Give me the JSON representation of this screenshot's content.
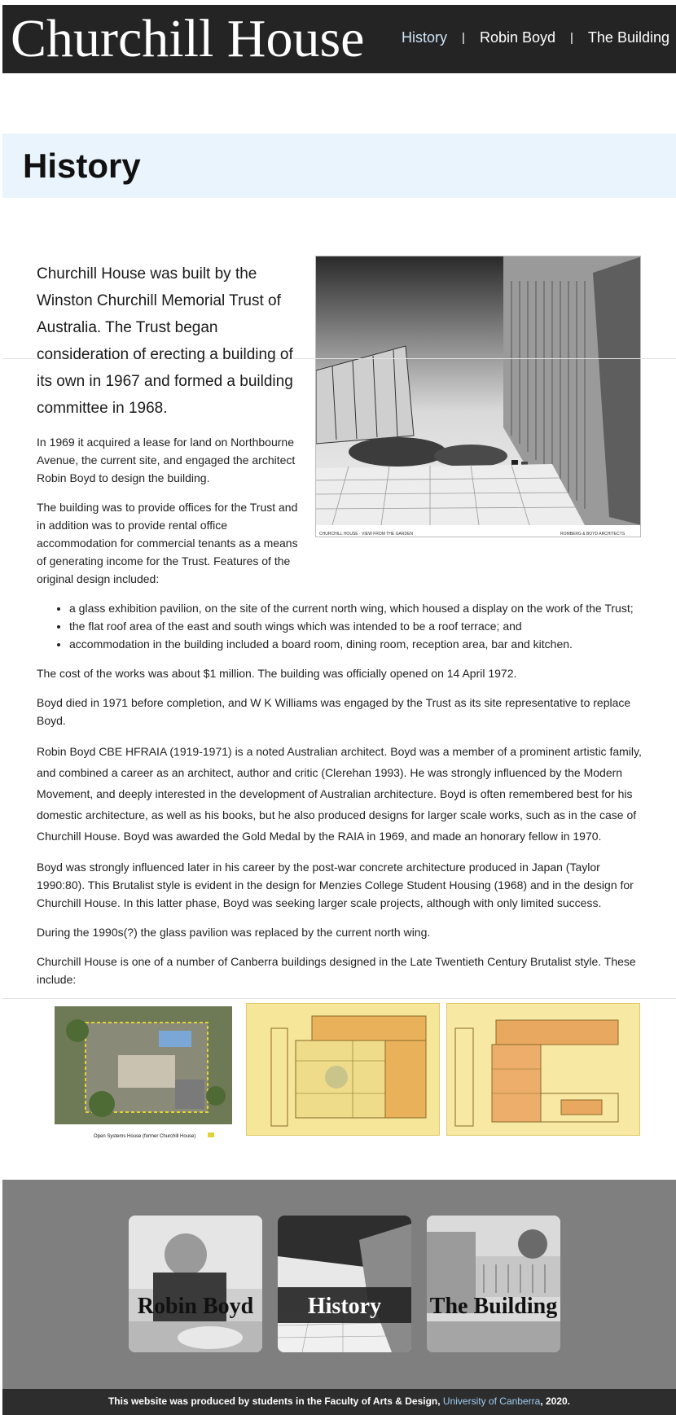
{
  "header": {
    "title": "Churchill House",
    "nav": [
      {
        "label": "History"
      },
      {
        "label": "Robin Boyd"
      },
      {
        "label": "The Building"
      }
    ],
    "separator": "|"
  },
  "banner": {
    "heading": "History"
  },
  "content": {
    "lead": "Churchill House was built by the Winston Churchill Memorial Trust of Australia. The Trust began consideration of erecting a building of its own in 1967 and formed a building committee in 1968.",
    "p1": "In 1969 it acquired a lease for land on Northbourne Avenue, the current site, and engaged the architect Robin Boyd to design the building.",
    "p2": "The building was to provide offices for the Trust and in addition was to provide rental office accommodation for commercial tenants as a means of generating income for the Trust. Features of the original design included:",
    "bullets": [
      "a glass exhibition pavilion, on the site of the current north wing, which housed a display on the work of the Trust;",
      "the flat roof area of the east and south wings which was intended to be a roof terrace; and",
      "accommodation in the building included a board room, dining room, reception area, bar and kitchen."
    ],
    "p3": "The cost of the works was about $1 million. The building was officially opened on 14 April 1972.",
    "p4": "Boyd died in 1971 before completion, and W K Williams was engaged by the Trust as its site representative to replace Boyd.",
    "p5": "Robin Boyd CBE HFRAIA (1919-1971) is a noted Australian architect. Boyd was a member of a prominent artistic family, and combined a career as an architect, author and critic (Clerehan 1993). He was strongly influenced by the Modern Movement, and deeply interested in the development of Australian architecture. Boyd is often remembered best for his domestic architecture, as well as his books, but he also produced designs for larger scale works, such as in the case of Churchill House. Boyd was awarded the Gold Medal by the RAIA in 1969, and made an honorary fellow in 1970.",
    "p6": "Boyd was strongly influenced later in his career by the post-war concrete architecture produced in Japan (Taylor 1990:80). This Brutalist style is evident in the design for Menzies College Student Housing (1968) and in the design for Churchill House. In this latter phase, Boyd was seeking larger scale projects, although with only limited success.",
    "p7": "During the 1990s(?) the glass pavilion was replaced by the current north wing.",
    "p8": "Churchill House is one of a number of Canberra buildings designed in the Late Twentieth Century Brutalist style. These include:"
  },
  "hero": {
    "caption_left": "CHURCHILL HOUSE · VIEW FROM THE GARDEN",
    "caption_right": "ROMBERG & BOYD ARCHITECTS"
  },
  "gallery": {
    "aerial_caption": "Open Systems House (former Churchill House)"
  },
  "cards": [
    {
      "label": "Robin Boyd"
    },
    {
      "label": "History"
    },
    {
      "label": "The Building"
    }
  ],
  "footer": {
    "text_before": "This website was produced by students in the Faculty of Arts & Design, ",
    "link": "University of Canberra",
    "text_after": ", 2020."
  },
  "colors": {
    "header_bg": "#242424",
    "banner_bg": "#e9f4fc",
    "feature_bg": "#7f7f7f",
    "footer_bg": "#2d2d2d",
    "link": "#9fcdf2"
  }
}
